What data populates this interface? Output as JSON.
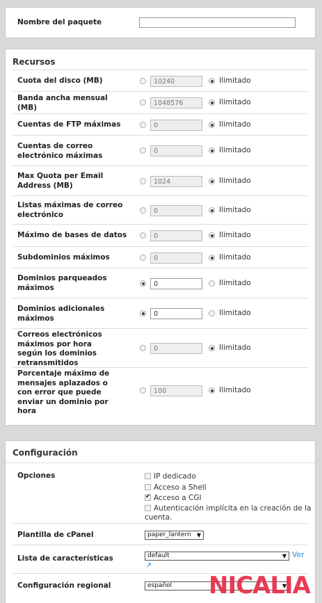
{
  "package": {
    "name_label": "Nombre del paquete",
    "name_value": ""
  },
  "resources": {
    "title": "Recursos",
    "unlimited_label": "Ilimitado",
    "rows": [
      {
        "label": "Cuota del disco (MB)",
        "value": "10240",
        "mode": "unlimited"
      },
      {
        "label": "Banda ancha mensual (MB)",
        "value": "1048576",
        "mode": "unlimited"
      },
      {
        "label": "Cuentas de FTP máximas",
        "value": "0",
        "mode": "unlimited"
      },
      {
        "label": "Cuentas de correo electrónico máximas",
        "value": "0",
        "mode": "unlimited"
      },
      {
        "label": "Max Quota per Email Address (MB)",
        "value": "1024",
        "mode": "unlimited"
      },
      {
        "label": "Listas máximas de correo electrónico",
        "value": "0",
        "mode": "unlimited"
      },
      {
        "label": "Máximo de bases de datos",
        "value": "0",
        "mode": "unlimited"
      },
      {
        "label": "Subdominios máximos",
        "value": "0",
        "mode": "unlimited"
      },
      {
        "label": "Dominios parqueados máximos",
        "value": "0",
        "mode": "custom"
      },
      {
        "label": "Dominios adicionales máximos",
        "value": "0",
        "mode": "custom"
      },
      {
        "label": "Correos electrónicos máximos por hora según los dominios retransmitidos",
        "value": "0",
        "mode": "unlimited"
      },
      {
        "label": "Porcentaje máximo de mensajes aplazados o con error que puede enviar un dominio por hora",
        "value": "100",
        "mode": "unlimited"
      }
    ]
  },
  "settings": {
    "title": "Configuración",
    "options_label": "Opciones",
    "options": [
      {
        "label": "IP dedicado",
        "checked": false
      },
      {
        "label": "Acceso a Shell",
        "checked": false
      },
      {
        "label": "Acceso a CGI",
        "checked": true
      },
      {
        "label": "Autenticación implícita en la creación de la cuenta.",
        "checked": false
      }
    ],
    "cpanel_theme_label": "Plantilla de cPanel",
    "cpanel_theme_value": "paper_lantern",
    "feature_list_label": "Lista de características",
    "feature_list_value": "default",
    "view_link": "Ver",
    "locale_label": "Configuración regional",
    "locale_value": "español"
  },
  "watermark": "NICALIA",
  "colors": {
    "link": "#2a8bd0",
    "logo": "#e8314b"
  }
}
